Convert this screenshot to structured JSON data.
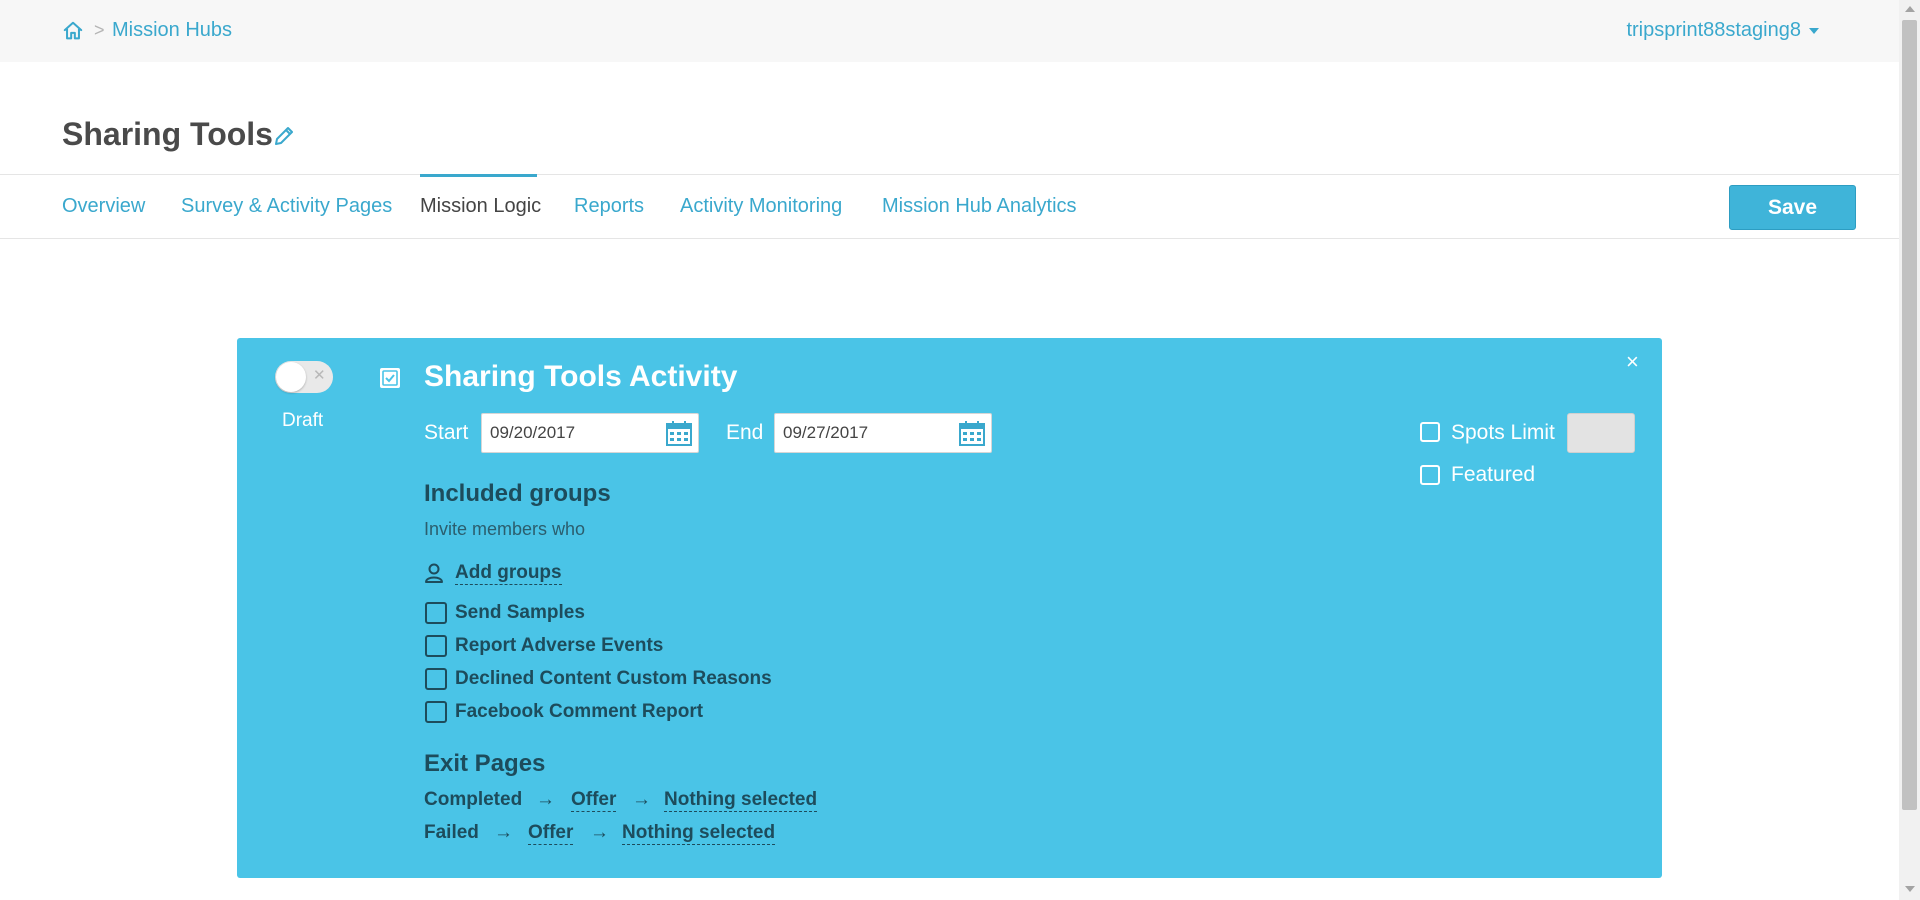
{
  "header": {
    "breadcrumb": {
      "home_icon": "home-icon",
      "separator": ">",
      "link": "Mission Hubs"
    },
    "user_menu": "tripsprint88staging8"
  },
  "page": {
    "title": "Sharing Tools"
  },
  "tabs": [
    {
      "label": "Overview"
    },
    {
      "label": "Survey & Activity Pages"
    },
    {
      "label": "Mission Logic",
      "active": true
    },
    {
      "label": "Reports"
    },
    {
      "label": "Activity Monitoring"
    },
    {
      "label": "Mission Hub Analytics"
    }
  ],
  "save_label": "Save",
  "activity": {
    "toggle_label": "Draft",
    "toggle_on": false,
    "title_checked": true,
    "title": "Sharing Tools Activity",
    "close_glyph": "×",
    "start_label": "Start",
    "start_value": "09/20/2017",
    "end_label": "End",
    "end_value": "09/27/2017",
    "spots_limit_label": "Spots Limit",
    "spots_limit_checked": false,
    "spots_limit_value": "",
    "featured_label": "Featured",
    "featured_checked": false,
    "included_groups_heading": "Included groups",
    "invite_text": "Invite members who",
    "add_groups_label": "Add groups",
    "groups": [
      {
        "label": "Send Samples",
        "checked": false
      },
      {
        "label": "Report Adverse Events",
        "checked": false
      },
      {
        "label": "Declined Content Custom Reasons",
        "checked": false
      },
      {
        "label": "Facebook Comment Report",
        "checked": false
      }
    ],
    "exit_pages_heading": "Exit Pages",
    "exit_pages": [
      {
        "status": "Completed",
        "arrow": "→",
        "page": "Offer",
        "target": "Nothing selected"
      },
      {
        "status": "Failed",
        "arrow": "→",
        "page": "Offer",
        "target": "Nothing selected"
      }
    ]
  },
  "colors": {
    "accent": "#3aa8cd",
    "card": "#4ac4e7",
    "dark_text": "#1d4c5c",
    "save_button": "#3fb4d9"
  }
}
